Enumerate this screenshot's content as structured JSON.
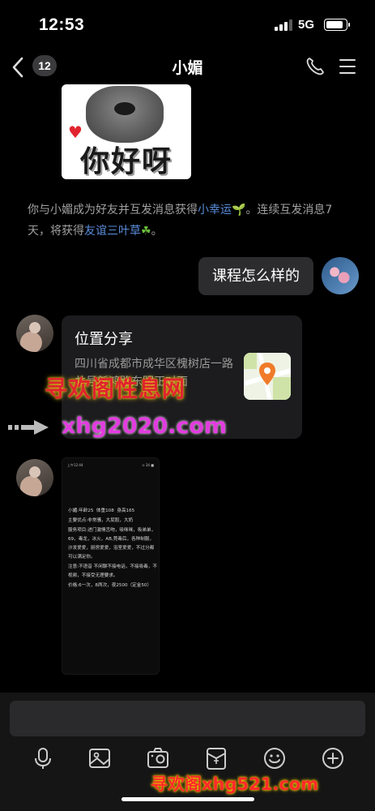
{
  "status_bar": {
    "time": "12:53",
    "network": "5G"
  },
  "nav": {
    "unread_count": "12",
    "title": "小媚"
  },
  "sticker": {
    "text": "你好呀"
  },
  "notice": {
    "part1": "你与小媚成为好友并互发消息获得",
    "link1": "小幸运",
    "part2": "。连续互发消息7天，将获得",
    "link2": "友谊三叶草",
    "part3": "。"
  },
  "my_message": {
    "text": "课程怎么样的"
  },
  "location": {
    "title": "位置分享",
    "address": "四川省成都市成华区槐树店一路共号新鸿路东明正对面"
  },
  "watermarks": {
    "top": "寻欢阁性息网",
    "middle": "xhg2020.com",
    "bottom": "寻欢阁xhg521.com"
  },
  "screenshot": {
    "status_left": "上午12:44",
    "status_right": "⊙ 34 ■",
    "lines": [
      "小媚:年龄25  体重108  身高165",
      "主要优点:非常骚，大屁股，大奶",
      "服务项目:进门激情舌吻，吸咪咪，吸弟弟，69，毒龙，冰火，AB,莞毒后，各种制服，沙发爱爱，厨房爱爱，浴室爱爱，不过分都可以满足你。",
      "注意:不语音 不闲聊不接电话，不接吸毒，不视频，不接受无理要求。",
      "价格:6一次，8两次，夜2500（定金50）"
    ]
  },
  "toolbar": [
    "microphone-icon",
    "image-icon",
    "camera-icon",
    "red-packet-icon",
    "emoji-icon",
    "plus-icon"
  ],
  "colors": {
    "background": "#000000",
    "bubble": "#2c2c2e",
    "link": "#5a8ddc",
    "watermark_red": "#e0242f",
    "watermark_magenta": "#e23be0"
  }
}
